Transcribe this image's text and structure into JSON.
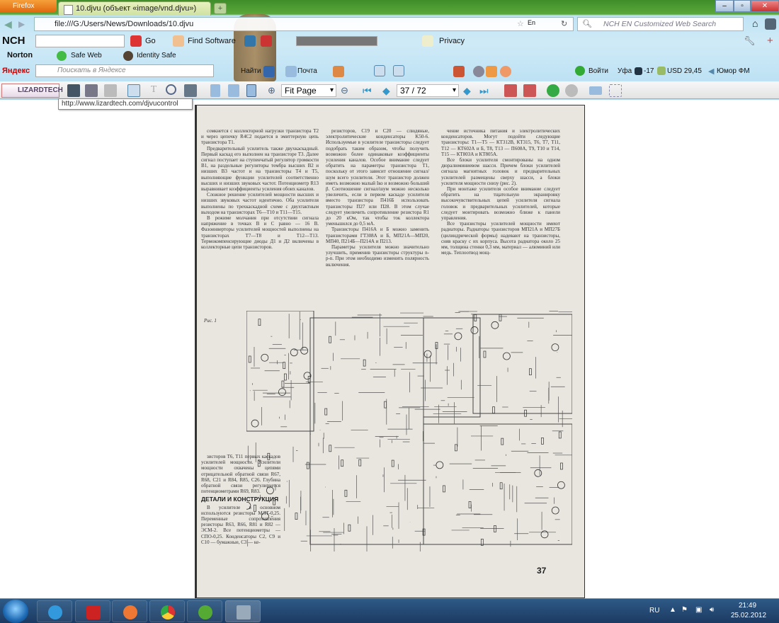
{
  "browser": {
    "menu_button": "Firefox",
    "tab_title": "10.djvu (объект «image/vnd.djvu»)",
    "new_tab": "+",
    "url": "file:///G:/Users/News/Downloads/10.djvu",
    "lang": "En",
    "search_placeholder": "NCH EN Customized Web Search",
    "window_controls": [
      "–",
      "▫",
      "✕"
    ]
  },
  "nch_bar": {
    "logo": "NCH",
    "go": "Go",
    "find_software": "Find Software",
    "privacy": "Privacy"
  },
  "norton_bar": {
    "logo": "Norton",
    "safe_web": "Safe Web",
    "identity_safe": "Identity Safe"
  },
  "yandex_bar": {
    "logo": "Яндекс",
    "search_placeholder": "Поискать в Яндексе",
    "find": "Найти",
    "mail": "Почта",
    "login": "Войти",
    "city": "Уфа",
    "temp": "-17",
    "currency": "USD 29,45",
    "radio": "Юмор ФМ"
  },
  "djvu_toolbar": {
    "brand": "LIZARDTECH",
    "zoom_value": "Fit Page",
    "page_value": "37 / 72",
    "tooltip": "http://www.lizardtech.com/djvucontrol"
  },
  "document": {
    "col1": [
      "сомкнется с коллекторной нагрузки транзистора T2 и через цепочку R4C2 подается в эмиттерную цепь транзистора T1.",
      "Предварительный усилитель также двухкаскадный. Первый каскад его выполнен на транзисторе T3. Далее сигнал поступает на ступенчатый регулятор громкости B1, на раздельные регуляторы тембра высших B2 и низших B3 частот и на транзисторы T4 и T5, выполняющие функции усилителей соответственно высших и низших звуковых частот. Потенциометр R13 выравнивает коэффициенты усиления обоих каналов.",
      "Сложное решение усилителей мощности высших и низших звуковых частот идентично. Оба усилителя выполнены по трехкаскадной схеме с двухтактным выходом на транзисторах T6—T10 и T11—T15.",
      "В режиме молчания при отсутствии сигнала напряжение в точках B и C равно — 16 В. Фазоинверторы усилителей мощностей выполнены на транзисторах T7—T8 и T12—T13. Термокомпенсирующие диоды Д1 и Д2 включены в коллекторные цепи транзисторов."
    ],
    "col2": [
      "резисторов, C19 и C20 — слюдяные, электролитические конденсаторы K50-6. Используемые в усилителе транзисторы следует подобрать таким образом, чтобы получить возможно более одинаковые коэффициенты усиления каналов. Особое внимание следует обратить на параметры транзистора T1, поскольку от этого зависит отношение сигнал/шум всего усилителя. Этот транзистор должен иметь возможно малый Iко и возможно больший β. Соотношение сигнал/шум можно несколько увеличить, если в первом каскаде усилителя вместо транзистора П416Б использовать транзисторы П27 или П28. В этом случае следует увеличить сопротивление резистора R1 до 20 кОм, так чтобы ток коллектора уменьшился до 0,5 мА.",
      "Транзисторы П416А и Б можно заменить транзисторами ГТ308А и Б, МП21А—МП20, МП40, П214Б—П214А и П213.",
      "Параметры усилителя можно значительно улучшить, применив транзисторы структуры n-p-n. При этом необходимо изменить полярность включения."
    ],
    "col3": [
      "чение источника питания и электролитических конденсаторов. Могут подойти следующие транзисторы: T1—T5 — КТ312В, КТ315, T6, T7, T11, T12 — КТ602А и Б, T8, T13 — П608А, T9, T10 и T14, T15 — КТ803А и КТ805А.",
      "Все блоки усилителя смонтированы на одном дюралюминиевом шасси. Причем блоки усилителей сигнала магнитных головок и предварительных усилителей размещены сверху шасси, а блоки усилителя мощности снизу (рис. 2).",
      "При монтаже усилителя особое внимание следует обратить на тщательную экранировку высокочувствительных цепей усилителя сигнала головок и предварительных усилителей, которые следует монтировать возможно ближе к панели управления.",
      "Все транзисторы усилителей мощности имеют радиаторы. Радиаторы транзисторов МП21А и МП27Б (цилиндрической формы) надевают на транзисторы, сняв краску с их корпуса. Высота радиатора около 25 мм, толщина стенки 0,3 мм, материал — алюминий или медь. Теплоотвод мощ-"
    ],
    "col1b": [
      "зисторов T6, T11 первых каскадов усилителей мощности. Усилители мощности охвачены цепями отрицательной обратной связи R67, R68, C21 и R84, R85, C26. Глубина обратной связи регулируется потенциометрами R69, R83."
    ],
    "heading": "ДЕТАЛИ И КОНСТРУКЦИЯ",
    "col1c": [
      "В усилителе в основном используются резисторы МЛТ-0,25. Переменные сопротивления резисторы R63, R66, R81 и R82 — ЭСМ-2. Все потенциометры — СПО-0,25. Конденсаторы C2, C9 и C10 — бумажные, C3 — ке-"
    ],
    "figure_label": "Рис. 1",
    "page_number": "37"
  },
  "taskbar": {
    "lang": "RU",
    "time": "21:49",
    "date": "25.02.2012",
    "apps": [
      "ie",
      "zynga",
      "firefox",
      "chrome",
      "utorrent",
      "djvu"
    ]
  }
}
